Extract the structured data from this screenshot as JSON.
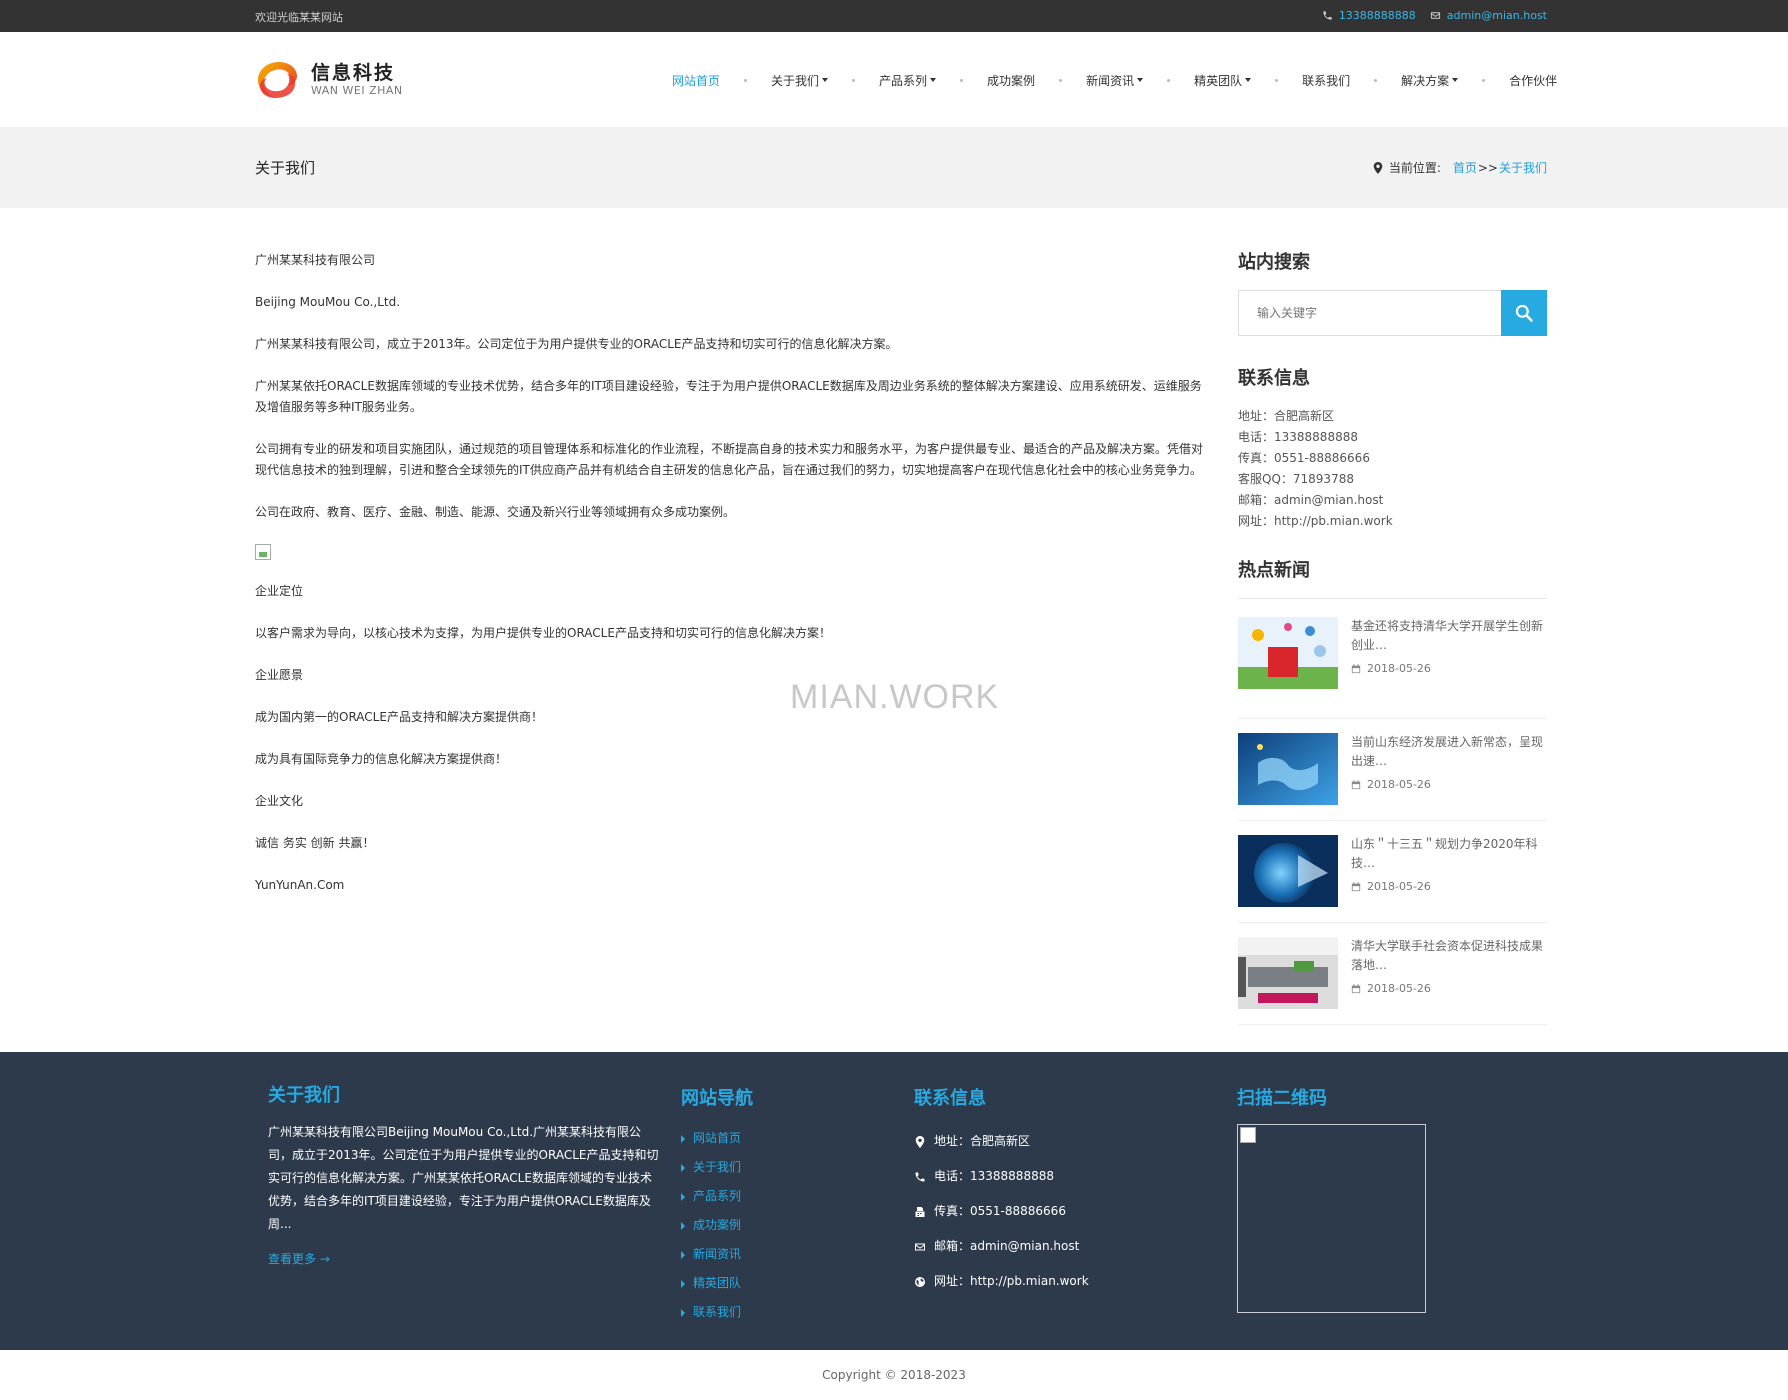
{
  "topbar": {
    "welcome": "欢迎光临某某网站",
    "phone": "13388888888",
    "email": "admin@mian.host"
  },
  "logo": {
    "cn": "信息科技",
    "en": "WAN WEI ZHAN"
  },
  "nav": [
    {
      "label": "网站首页",
      "active": true,
      "dropdown": false
    },
    {
      "label": "关于我们",
      "dropdown": true
    },
    {
      "label": "产品系列",
      "dropdown": true
    },
    {
      "label": "成功案例",
      "dropdown": false
    },
    {
      "label": "新闻资讯",
      "dropdown": true
    },
    {
      "label": "精英团队",
      "dropdown": true
    },
    {
      "label": "联系我们",
      "dropdown": false
    },
    {
      "label": "解决方案",
      "dropdown": true
    },
    {
      "label": "合作伙伴",
      "dropdown": false
    }
  ],
  "band": {
    "title": "关于我们",
    "crumb_label": "当前位置:",
    "crumb_home": "首页",
    "crumb_sep": ">>",
    "crumb_current": "关于我们"
  },
  "content": {
    "p1": "广州某某科技有限公司",
    "p2": "Beijing MouMou Co.,Ltd.",
    "p3": "广州某某科技有限公司，成立于2013年。公司定位于为用户提供专业的ORACLE产品支持和切实可行的信息化解决方案。",
    "p4": "广州某某依托ORACLE数据库领域的专业技术优势，结合多年的IT项目建设经验，专注于为用户提供ORACLE数据库及周边业务系统的整体解决方案建设、应用系统研发、运维服务及增值服务等多种IT服务业务。",
    "p5": "公司拥有专业的研发和项目实施团队，通过规范的项目管理体系和标准化的作业流程，不断提高自身的技术实力和服务水平，为客户提供最专业、最适合的产品及解决方案。凭借对现代信息技术的独到理解，引进和整合全球领先的IT供应商产品并有机结合自主研发的信息化产品，旨在通过我们的努力，切实地提高客户在现代信息化社会中的核心业务竞争力。",
    "p6": "公司在政府、教育、医疗、金融、制造、能源、交通及新兴行业等领域拥有众多成功案例。",
    "p7": "企业定位",
    "p8": "以客户需求为导向，以核心技术为支撑，为用户提供专业的ORACLE产品支持和切实可行的信息化解决方案！",
    "p9": "企业愿景",
    "p10": "成为国内第一的ORACLE产品支持和解决方案提供商！",
    "p11": "成为具有国际竞争力的信息化解决方案提供商！",
    "p12": "企业文化",
    "p13": "诚信 务实 创新 共赢！",
    "p14": "YunYunAn.Com"
  },
  "watermark": "MIAN.WORK",
  "sidebar": {
    "search_title": "站内搜索",
    "search_placeholder": "输入关键字",
    "contact_title": "联系信息",
    "contact": [
      "地址：合肥高新区",
      "电话：13388888888",
      "传真：0551-88886666",
      "客服QQ：71893788",
      "邮箱：admin@mian.host",
      "网址：http://pb.mian.work"
    ],
    "news_title": "热点新闻",
    "news": [
      {
        "title": "基金还将支持清华大学开展学生创新创业…",
        "date": "2018-05-26"
      },
      {
        "title": "当前山东经济发展进入新常态，呈现出速…",
        "date": "2018-05-26"
      },
      {
        "title": "山东＂十三五＂规划力争2020年科技…",
        "date": "2018-05-26"
      },
      {
        "title": "清华大学联手社会资本促进科技成果落地…",
        "date": "2018-05-26"
      }
    ]
  },
  "footer": {
    "about_title": "关于我们",
    "about_text": "广州某某科技有限公司Beijing MouMou Co.,Ltd.广州某某科技有限公司，成立于2013年。公司定位于为用户提供专业的ORACLE产品支持和切实可行的信息化解决方案。广州某某依托ORACLE数据库领域的专业技术优势，结合多年的IT项目建设经验，专注于为用户提供ORACLE数据库及周...",
    "more": "查看更多 →",
    "nav_title": "网站导航",
    "nav": [
      "网站首页",
      "关于我们",
      "产品系列",
      "成功案例",
      "新闻资讯",
      "精英团队",
      "联系我们"
    ],
    "contact_title": "联系信息",
    "contact": [
      {
        "icon": "map-pin-icon",
        "text": "地址：合肥高新区"
      },
      {
        "icon": "phone-icon",
        "text": "电话：13388888888"
      },
      {
        "icon": "fax-icon",
        "text": "传真：0551-88886666"
      },
      {
        "icon": "envelope-icon",
        "text": "邮箱：admin@mian.host"
      },
      {
        "icon": "globe-icon",
        "text": "网址：http://pb.mian.work"
      }
    ],
    "qr_title": "扫描二维码"
  },
  "copyright": "Copyright © 2018-2023",
  "colors": {
    "accent": "#27a9e1",
    "topbar": "#333333",
    "footer": "#2d3a4b",
    "band": "#f2f2f2"
  }
}
